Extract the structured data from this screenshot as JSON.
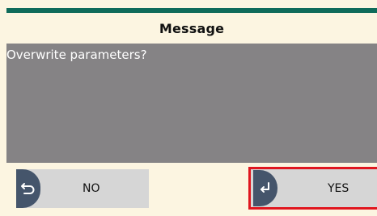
{
  "dialog": {
    "title": "Message",
    "message": "Overwrite parameters?",
    "buttons": {
      "no": {
        "label": "NO",
        "icon": "back-arrow-icon"
      },
      "yes": {
        "label": "YES",
        "icon": "enter-return-icon",
        "selected": true
      }
    }
  },
  "colors": {
    "background": "#fcf5e1",
    "accent_line": "#0f6b5a",
    "message_area": "#858385",
    "button_face": "#d6d6d6",
    "icon_pill": "#45556b",
    "selection_border": "#e0161f"
  }
}
